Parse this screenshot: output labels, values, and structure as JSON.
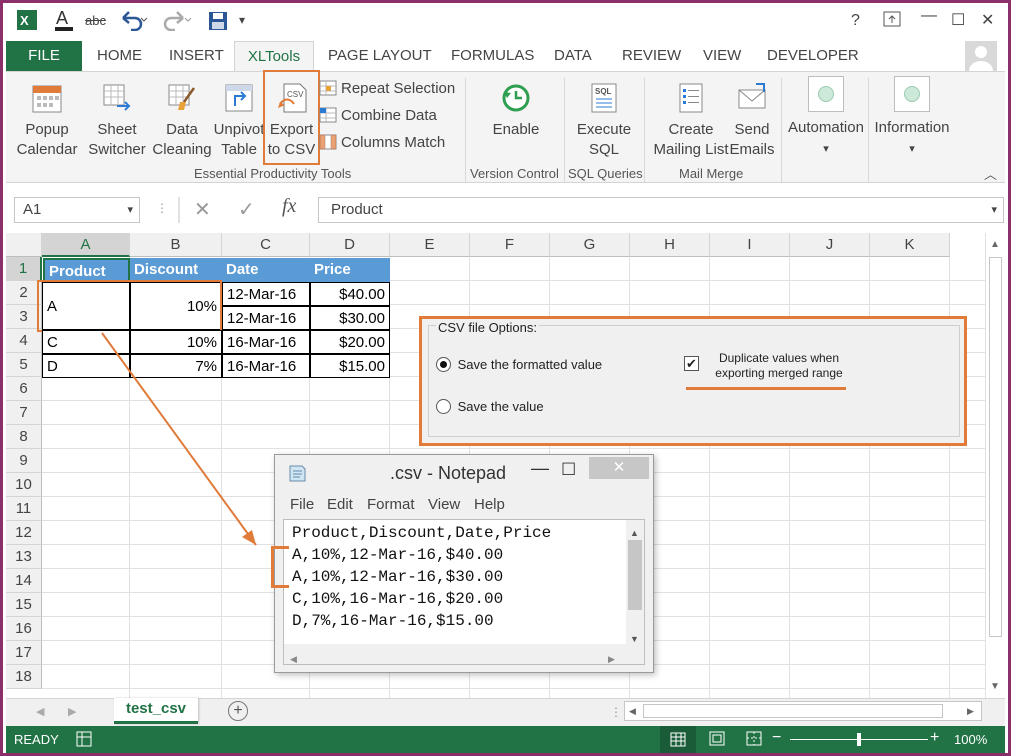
{
  "quick_access": {
    "excel_icon": "excel-icon",
    "font_color_icon": "font-color-icon",
    "spelling": "abc",
    "undo_icon": "undo-icon",
    "redo_icon": "redo-icon",
    "save_icon": "save-icon"
  },
  "window_controls": {
    "help": "?",
    "restore_icon": "ribbon-display-icon",
    "minimize": "—",
    "maximize": "☐",
    "close": "✕"
  },
  "tabs": [
    "FILE",
    "HOME",
    "INSERT",
    "XLTools",
    "PAGE LAYOUT",
    "FORMULAS",
    "DATA",
    "REVIEW",
    "VIEW",
    "DEVELOPER"
  ],
  "ribbon": {
    "popup_calendar": [
      "Popup",
      "Calendar"
    ],
    "sheet_switcher": [
      "Sheet",
      "Switcher"
    ],
    "data_cleaning": [
      "Data",
      "Cleaning"
    ],
    "unpivot_table": [
      "Unpivot",
      "Table"
    ],
    "export_to_csv": [
      "Export",
      "to CSV"
    ],
    "repeat_selection": "Repeat Selection",
    "combine_data": "Combine Data",
    "columns_match": "Columns Match",
    "group_essential": "Essential Productivity Tools",
    "enable": "Enable",
    "group_version": "Version Control",
    "execute_sql": [
      "Execute",
      "SQL"
    ],
    "group_sql": "SQL Queries",
    "create_mailing": [
      "Create",
      "Mailing List"
    ],
    "send_emails": [
      "Send",
      "Emails"
    ],
    "group_mail": "Mail Merge",
    "automation": "Automation",
    "information": "Information"
  },
  "formula_bar": {
    "name_box": "A1",
    "cancel": "✕",
    "enter": "✓",
    "fx": "fx",
    "value": "Product"
  },
  "columns": [
    "A",
    "B",
    "C",
    "D",
    "E",
    "F",
    "G",
    "H",
    "I",
    "J",
    "K"
  ],
  "rows": [
    "1",
    "2",
    "3",
    "4",
    "5",
    "6",
    "7",
    "8",
    "9",
    "10",
    "11",
    "12",
    "13",
    "14",
    "15",
    "16",
    "17",
    "18"
  ],
  "table": {
    "headers": [
      "Product",
      "Discount",
      "Date",
      "Price"
    ],
    "merged_product": "A",
    "merged_discount": "10%",
    "rows": [
      {
        "date": "12-Mar-16",
        "price": "$40.00"
      },
      {
        "date": "12-Mar-16",
        "price": "$30.00"
      },
      {
        "product": "C",
        "discount": "10%",
        "date": "16-Mar-16",
        "price": "$20.00"
      },
      {
        "product": "D",
        "discount": "7%",
        "date": "16-Mar-16",
        "price": "$15.00"
      }
    ]
  },
  "csv_options": {
    "title": "CSV file Options:",
    "opt_formatted": "Save the formatted value",
    "opt_value": "Save the value",
    "dup_line1": "Duplicate  values  when",
    "dup_line2": "exporting merged range",
    "formatted_selected": true,
    "duplicate_checked": true
  },
  "notepad": {
    "title": ".csv - Notepad",
    "menu": [
      "File",
      "Edit",
      "Format",
      "View",
      "Help"
    ],
    "lines": [
      "Product,Discount,Date,Price",
      "A,10%,12-Mar-16,$40.00",
      "A,10%,12-Mar-16,$30.00",
      "C,10%,16-Mar-16,$20.00",
      "D,7%,16-Mar-16,$15.00"
    ]
  },
  "sheet": {
    "name": "test_csv",
    "add": "+"
  },
  "status": {
    "ready": "READY",
    "zoom": "100%",
    "zoom_minus": "−",
    "zoom_plus": "+"
  },
  "colors": {
    "excel_green": "#217346",
    "header_blue": "#5b9bd5",
    "highlight_orange": "#e07b39",
    "frame": "#8b2f6b"
  }
}
